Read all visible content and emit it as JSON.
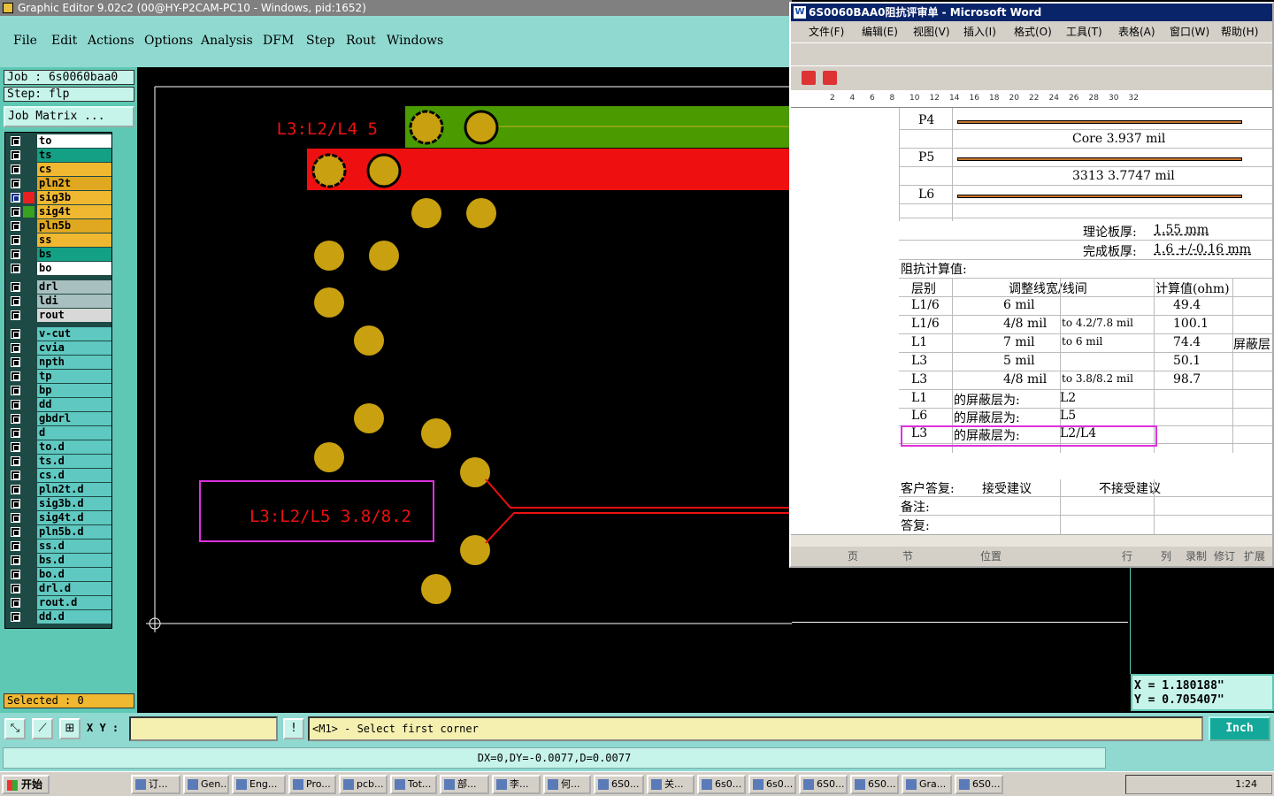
{
  "genesis": {
    "title": "Graphic Editor 9.02c2 (00@HY-P2CAM-PC10 - Windows, pid:1652)",
    "menu": [
      "File",
      "Edit",
      "Actions",
      "Options",
      "Analysis",
      "DFM",
      "Step",
      "Rout",
      "Windows"
    ],
    "job_label": "Job : 6s0060baa0",
    "step_label": "Step: flp",
    "job_matrix": "Job Matrix ...",
    "layers": [
      {
        "name": "to",
        "color": "#ffffff"
      },
      {
        "name": "ts",
        "color": "#14a085"
      },
      {
        "name": "cs",
        "color": "#f0b830"
      },
      {
        "name": "pln2t",
        "color": "#e0a820"
      },
      {
        "name": "sig3b",
        "color": "#f0b830",
        "swatch": "#e82020",
        "selected": true
      },
      {
        "name": "sig4t",
        "color": "#f0b830",
        "swatch": "#3aa020"
      },
      {
        "name": "pln5b",
        "color": "#e0a820"
      },
      {
        "name": "ss",
        "color": "#f0b830"
      },
      {
        "name": "bs",
        "color": "#14a085"
      },
      {
        "name": "bo",
        "color": "#ffffff"
      },
      {
        "name": "drl",
        "color": "#a8c0c0"
      },
      {
        "name": "ldi",
        "color": "#a8c0c0"
      },
      {
        "name": "rout",
        "color": "#d8d8d8"
      },
      {
        "name": "v-cut",
        "color": "#5fc8c0"
      },
      {
        "name": "cvia",
        "color": "#5fc8c0"
      },
      {
        "name": "npth",
        "color": "#5fc8c0"
      },
      {
        "name": "tp",
        "color": "#5fc8c0"
      },
      {
        "name": "bp",
        "color": "#5fc8c0"
      },
      {
        "name": "dd",
        "color": "#5fc8c0"
      },
      {
        "name": "gbdrl",
        "color": "#5fc8c0"
      },
      {
        "name": "d",
        "color": "#5fc8c0"
      },
      {
        "name": "to.d",
        "color": "#5fc8c0"
      },
      {
        "name": "ts.d",
        "color": "#5fc8c0"
      },
      {
        "name": "cs.d",
        "color": "#5fc8c0"
      },
      {
        "name": "pln2t.d",
        "color": "#5fc8c0"
      },
      {
        "name": "sig3b.d",
        "color": "#5fc8c0"
      },
      {
        "name": "sig4t.d",
        "color": "#5fc8c0"
      },
      {
        "name": "pln5b.d",
        "color": "#5fc8c0"
      },
      {
        "name": "ss.d",
        "color": "#5fc8c0"
      },
      {
        "name": "bs.d",
        "color": "#5fc8c0"
      },
      {
        "name": "bo.d",
        "color": "#5fc8c0"
      },
      {
        "name": "drl.d",
        "color": "#5fc8c0"
      },
      {
        "name": "rout.d",
        "color": "#5fc8c0"
      },
      {
        "name": "dd.d",
        "color": "#5fc8c0"
      }
    ],
    "selected": "Selected : 0",
    "canvas_text_top": "L3:L2/L4 5",
    "canvas_text_box": "L3:L2/L5 3.8/8.2",
    "xy_label": "X Y :",
    "prompt": "<M1> - Select first corner",
    "unit": "Inch",
    "dxdy": "DX=0,DY=-0.0077,D=0.0077",
    "coord_x": "X = 1.180188\"",
    "coord_y": "Y = 0.705407\""
  },
  "word": {
    "title": "6S0060BAA0阻抗评审单 - Microsoft Word",
    "menu": [
      "文件(F)",
      "编辑(E)",
      "视图(V)",
      "插入(I)",
      "格式(O)",
      "工具(T)",
      "表格(A)",
      "窗口(W)",
      "帮助(H)"
    ],
    "ruler": [
      "2",
      "4",
      "6",
      "8",
      "10",
      "12",
      "14",
      "16",
      "18",
      "20",
      "22",
      "24",
      "26",
      "28",
      "30",
      "32"
    ],
    "stack": [
      {
        "label": "P4"
      },
      {
        "text": "Core   3.937 mil"
      },
      {
        "label": "P5"
      },
      {
        "text": "3313   3.7747 mil"
      },
      {
        "label": "L6"
      }
    ],
    "theory_label": "理论板厚:",
    "theory_value": "1.55 mm",
    "final_label": "完成板厚:",
    "final_value": "1.6 +/-0.16 mm",
    "imp_title": "阻抗计算值:",
    "col_layer": "层别",
    "col_width": "调整线宽/线间",
    "col_calc": "计算值(ohm)",
    "imp_rows": [
      {
        "layer": "L1/6",
        "width": "6 mil",
        "to": "",
        "calc": "49.4",
        "extra": ""
      },
      {
        "layer": "L1/6",
        "width": "4/8 mil",
        "to": "to 4.2/7.8 mil",
        "calc": "100.1",
        "extra": ""
      },
      {
        "layer": "L1",
        "width": "7 mil",
        "to": "to 6 mil",
        "calc": "74.4",
        "extra": "屏蔽层"
      },
      {
        "layer": "L3",
        "width": "5 mil",
        "to": "",
        "calc": "50.1",
        "extra": ""
      },
      {
        "layer": "L3",
        "width": "4/8 mil",
        "to": "to 3.8/8.2 mil",
        "calc": "98.7",
        "extra": ""
      }
    ],
    "shield_label": "的屏蔽层为:",
    "shield_rows": [
      {
        "layer": "L1",
        "value": "L2"
      },
      {
        "layer": "L6",
        "value": "L5"
      },
      {
        "layer": "L3",
        "value": "L2/L4"
      }
    ],
    "reply_label": "客户答复:",
    "accept": "接受建议",
    "reject": "不接受建议",
    "note_label": "备注:",
    "answer_label": "答复:",
    "status": [
      "页",
      "节",
      "位置",
      "行",
      "列",
      "录制",
      "修订",
      "扩展"
    ]
  },
  "taskbar": {
    "start": "开始",
    "items": [
      "订...",
      "Gen...",
      "Eng...",
      "Pro...",
      "pcb...",
      "Tot...",
      "部...",
      "李...",
      "何...",
      "6S0...",
      "关...",
      "6s0...",
      "6s0...",
      "6S0...",
      "6S0...",
      "Gra...",
      "6S0..."
    ],
    "clock": "1:24"
  }
}
